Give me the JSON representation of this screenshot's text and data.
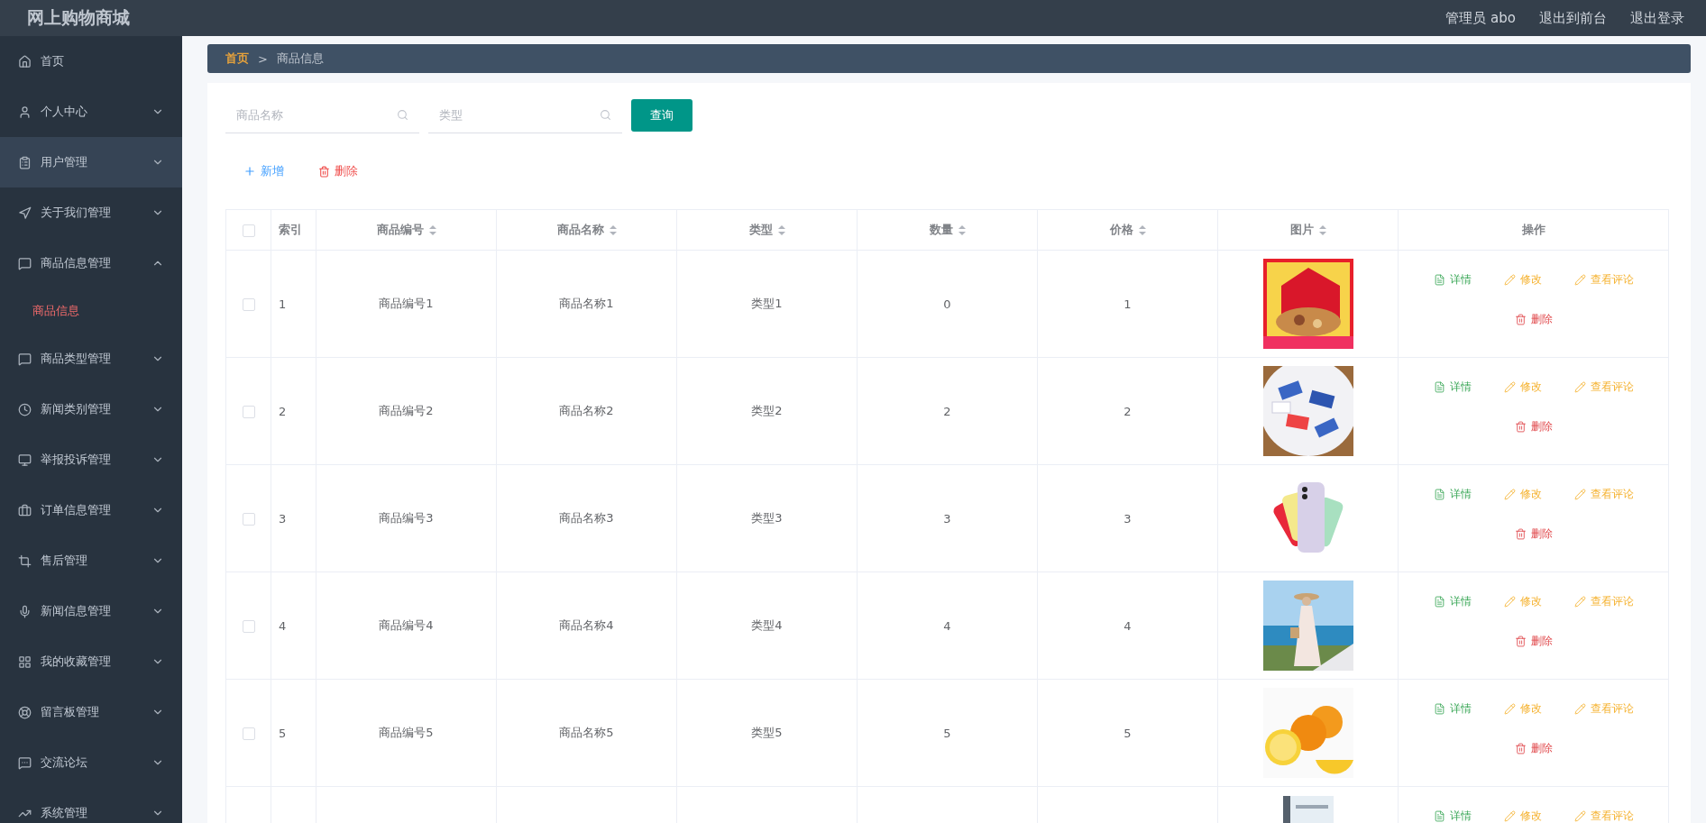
{
  "app_title": "网上购物商城",
  "header_links": [
    {
      "label": "管理员 abo"
    },
    {
      "label": "退出到前台"
    },
    {
      "label": "退出登录"
    }
  ],
  "sidebar": {
    "items": [
      {
        "label": "首页",
        "hovered": false
      },
      {
        "label": "个人中心",
        "expanded": false,
        "hovered": false
      },
      {
        "label": "用户管理",
        "expanded": false,
        "hovered": true
      },
      {
        "label": "关于我们管理",
        "expanded": false,
        "hovered": false
      },
      {
        "label": "商品信息管理",
        "expanded": true,
        "hovered": false,
        "children": [
          {
            "label": "商品信息",
            "selected": true
          }
        ]
      },
      {
        "label": "商品类型管理",
        "expanded": false,
        "hovered": false
      },
      {
        "label": "新闻类别管理",
        "expanded": false,
        "hovered": false
      },
      {
        "label": "举报投诉管理",
        "expanded": false,
        "hovered": false
      },
      {
        "label": "订单信息管理",
        "expanded": false,
        "hovered": false
      },
      {
        "label": "售后管理",
        "expanded": false,
        "hovered": false
      },
      {
        "label": "新闻信息管理",
        "expanded": false,
        "hovered": false
      },
      {
        "label": "我的收藏管理",
        "expanded": false,
        "hovered": false
      },
      {
        "label": "留言板管理",
        "expanded": false,
        "hovered": false
      },
      {
        "label": "交流论坛",
        "expanded": false,
        "hovered": false
      },
      {
        "label": "系统管理",
        "expanded": false,
        "hovered": false
      }
    ]
  },
  "breadcrumb": [
    {
      "label": "首页",
      "selected": false
    },
    {
      "label": ">",
      "kind": "separator"
    },
    {
      "label": "商品信息",
      "selected": true
    }
  ],
  "search": {
    "fields": [
      {
        "placeholder": "商品名称"
      },
      {
        "placeholder": "类型"
      }
    ],
    "button": "查询"
  },
  "toolbar": [
    {
      "label": "新增",
      "kind": "add"
    },
    {
      "label": "删除",
      "kind": "delete"
    }
  ],
  "table": {
    "select_all": {
      "checked": false
    },
    "columns": [
      {
        "label": "索引",
        "sortable": false
      },
      {
        "label": "商品编号",
        "sortable": true
      },
      {
        "label": "商品名称",
        "sortable": true
      },
      {
        "label": "类型",
        "sortable": true
      },
      {
        "label": "数量",
        "sortable": true
      },
      {
        "label": "价格",
        "sortable": true
      },
      {
        "label": "图片",
        "sortable": true
      },
      {
        "label": "操作",
        "sortable": false
      }
    ],
    "rows": [
      {
        "checked": false,
        "cells": [
          "1",
          "商品编号1",
          "商品名称1",
          "类型1",
          "0",
          "1"
        ],
        "image": {
          "kind": "picture"
        },
        "actions": [
          {
            "label": "详情",
            "kind": "detail"
          },
          {
            "label": "修改",
            "kind": "edit"
          },
          {
            "label": "查看评论",
            "kind": "comments"
          },
          {
            "label": "删除",
            "kind": "delete"
          }
        ]
      },
      {
        "checked": false,
        "cells": [
          "2",
          "商品编号2",
          "商品名称2",
          "类型2",
          "2",
          "2"
        ],
        "image": {
          "kind": "picture"
        },
        "actions": [
          {
            "label": "详情",
            "kind": "detail"
          },
          {
            "label": "修改",
            "kind": "edit"
          },
          {
            "label": "查看评论",
            "kind": "comments"
          },
          {
            "label": "删除",
            "kind": "delete"
          }
        ]
      },
      {
        "checked": false,
        "cells": [
          "3",
          "商品编号3",
          "商品名称3",
          "类型3",
          "3",
          "3"
        ],
        "image": {
          "kind": "picture"
        },
        "actions": [
          {
            "label": "详情",
            "kind": "detail"
          },
          {
            "label": "修改",
            "kind": "edit"
          },
          {
            "label": "查看评论",
            "kind": "comments"
          },
          {
            "label": "删除",
            "kind": "delete"
          }
        ]
      },
      {
        "checked": false,
        "cells": [
          "4",
          "商品编号4",
          "商品名称4",
          "类型4",
          "4",
          "4"
        ],
        "image": {
          "kind": "picture"
        },
        "actions": [
          {
            "label": "详情",
            "kind": "detail"
          },
          {
            "label": "修改",
            "kind": "edit"
          },
          {
            "label": "查看评论",
            "kind": "comments"
          },
          {
            "label": "删除",
            "kind": "delete"
          }
        ]
      },
      {
        "checked": false,
        "cells": [
          "5",
          "商品编号5",
          "商品名称5",
          "类型5",
          "5",
          "5"
        ],
        "image": {
          "kind": "picture"
        },
        "actions": [
          {
            "label": "详情",
            "kind": "detail"
          },
          {
            "label": "修改",
            "kind": "edit"
          },
          {
            "label": "查看评论",
            "kind": "comments"
          },
          {
            "label": "删除",
            "kind": "delete"
          }
        ]
      },
      {
        "cells": [],
        "image": {
          "kind": "picture"
        },
        "actions": [
          {
            "label": "详情",
            "kind": "detail"
          },
          {
            "label": "修改",
            "kind": "edit"
          },
          {
            "label": "查看评论",
            "kind": "comments"
          }
        ]
      }
    ]
  }
}
